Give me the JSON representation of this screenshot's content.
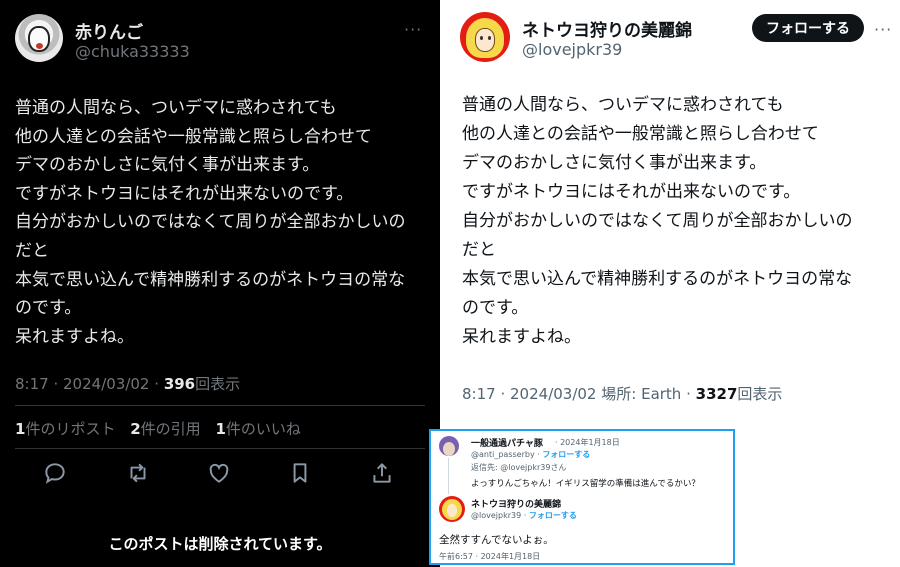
{
  "left_tweet": {
    "avatar": "user-avatar",
    "display_name": "赤りんご",
    "handle": "@chuka33333",
    "more": "···",
    "text": "普通の人間なら、ついデマに惑わされても\n他の人達との会話や一般常識と照らし合わせて\nデマのおかしさに気付く事が出来ます。\nですがネトウヨにはそれが出来ないのです。\n自分がおかしいのではなくて周りが全部おかしいの\nだと\n本気で思い込んで精神勝利するのがネトウヨの常な\nのです。\n呆れますよね。",
    "time": "8:17",
    "date": "2024/03/02",
    "views_count": "396",
    "views_label": "回表示",
    "reposts_count": "1",
    "reposts_label": "件のリポスト",
    "quotes_count": "2",
    "quotes_label": "件の引用",
    "likes_count": "1",
    "likes_label": "件のいいね",
    "actions": [
      "reply-icon",
      "repost-icon",
      "like-icon",
      "bookmark-icon",
      "share-icon"
    ],
    "deleted_notice": "このポストは削除されています。"
  },
  "right_tweet": {
    "avatar": "user-avatar",
    "display_name": "ネトウヨ狩りの美麗錦",
    "handle": "@lovejpkr39",
    "follow_label": "フォローする",
    "more": "···",
    "text": "普通の人間なら、ついデマに惑わされても\n他の人達との会話や一般常識と照らし合わせて\nデマのおかしさに気付く事が出来ます。\nですがネトウヨにはそれが出来ないのです。\n自分がおかしいのではなくて周りが全部おかしいの\nだと\n本気で思い込んで精神勝利するのがネトウヨの常な\nのです。\n呆れますよね。",
    "time": "8:17",
    "date": "2024/03/02",
    "location_label": "場所: Earth",
    "views_count": "3327",
    "views_label": "回表示"
  },
  "reply_screenshot": {
    "parent": {
      "display_name": "一般通過パチャ豚",
      "date": "· 2024年1月18日",
      "handle": "@anti_passerby",
      "follow_label": "フォローする",
      "reply_to_label": "返信先:",
      "reply_to_handle": "@lovejpkr39",
      "reply_to_suffix": "さん",
      "text": "よっすりんごちゃん！イギリス留学の準備は進んでるかい？"
    },
    "reply": {
      "display_name": "ネトウヨ狩りの美麗錦",
      "handle": "@lovejpkr39",
      "follow_label": "フォローする",
      "text": "全然すすんでないよぉ。",
      "meta": "午前6:57 · 2024年1月18日"
    },
    "border_color": "#1da1f2"
  },
  "colors": {
    "dark_bg": "#000000",
    "light_bg": "#ffffff",
    "link_blue": "#1d9bf0",
    "muted_dark": "#71767b",
    "muted_light": "#536471"
  }
}
